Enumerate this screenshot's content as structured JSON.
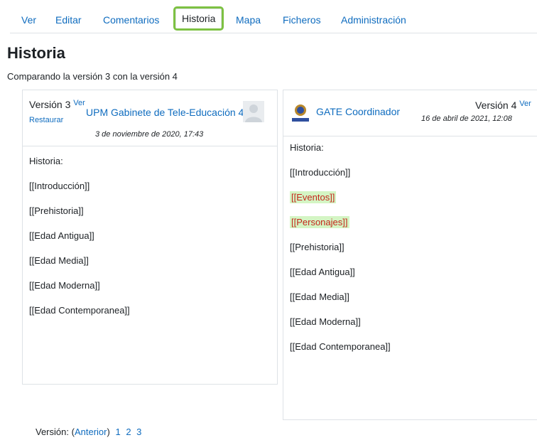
{
  "tabs": [
    {
      "label": "Ver"
    },
    {
      "label": "Editar"
    },
    {
      "label": "Comentarios"
    },
    {
      "label": "Historia"
    },
    {
      "label": "Mapa"
    },
    {
      "label": "Ficheros"
    },
    {
      "label": "Administración"
    }
  ],
  "page": {
    "title": "Historia",
    "compare_note": "Comparando la versión 3 con la versión 4"
  },
  "left": {
    "version": "Versión 3",
    "view_link": "Ver",
    "restore_link": "Restaurar",
    "user": "UPM Gabinete de Tele-Educación 4",
    "date": "3 de noviembre de 2020, 17:43",
    "lines": [
      {
        "text": "Historia:"
      },
      {
        "text": "[[Introducción]]"
      },
      {
        "text": "[[Prehistoria]]"
      },
      {
        "text": "[[Edad Antigua]]"
      },
      {
        "text": "[[Edad Media]]"
      },
      {
        "text": "[[Edad Moderna]]"
      },
      {
        "text": "[[Edad Contemporanea]]"
      }
    ]
  },
  "right": {
    "version": "Versión 4",
    "view_link": "Ver",
    "user": "GATE Coordinador",
    "logo_text": "POLITÉCNICA",
    "date": "16 de abril de 2021, 12:08",
    "lines": [
      {
        "text": "Historia:",
        "added": false
      },
      {
        "text": "[[Introducción]]",
        "added": false
      },
      {
        "text": "[[Eventos]]",
        "added": true
      },
      {
        "text": "[[Personajes]]",
        "added": true
      },
      {
        "text": "[[Prehistoria]]",
        "added": false
      },
      {
        "text": "[[Edad Antigua]]",
        "added": false
      },
      {
        "text": "[[Edad Media]]",
        "added": false
      },
      {
        "text": "[[Edad Moderna]]",
        "added": false
      },
      {
        "text": "[[Edad Contemporanea]]",
        "added": false
      }
    ]
  },
  "footer": {
    "label": "Versión:",
    "previous_open": "(",
    "previous": "Anterior",
    "previous_close": ")",
    "pages": [
      "1",
      "2",
      "3"
    ]
  },
  "colors": {
    "link": "#0f6cbf",
    "active_tab_outline": "#7dc142",
    "added_text": "#c5271c",
    "added_bg": "#d4f5c4"
  }
}
